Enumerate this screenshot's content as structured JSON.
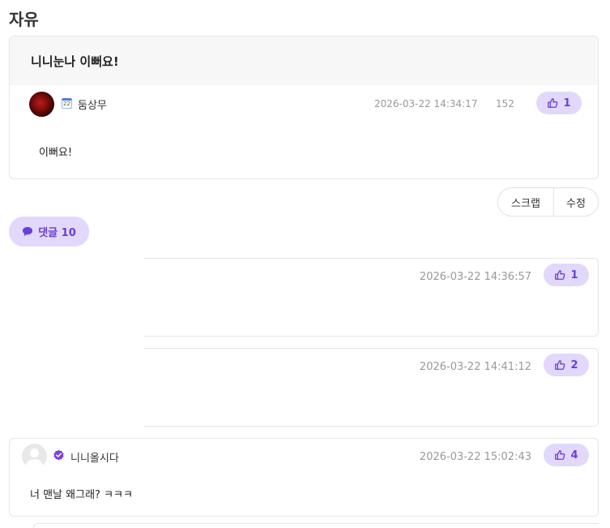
{
  "board": {
    "title": "자유"
  },
  "post": {
    "title": "니니눈나 이뻐요!",
    "author": "둠상무",
    "badge_day": "22",
    "date": "2026-03-22 14:34:17",
    "views": "152",
    "likes": "1",
    "body": "이뻐요!"
  },
  "actions": {
    "scrap_label": "스크랩",
    "edit_label": "수정"
  },
  "comments_toggle": {
    "label": "댓글 10"
  },
  "comments": [
    {
      "date": "2026-03-22 14:36:57",
      "likes": "1"
    },
    {
      "date": "2026-03-22 14:41:12",
      "likes": "2"
    },
    {
      "author": "니니올시다",
      "date": "2026-03-22 15:02:43",
      "likes": "4",
      "text": "너 맨날 왜그래? ㅋㅋㅋ"
    }
  ],
  "colors": {
    "accent": "#6a3fd6",
    "accent_bg": "#e1d8fb",
    "muted": "#999999"
  },
  "icons": {
    "like": "thumbs-up-icon",
    "comment": "speech-bubble-icon",
    "verified": "verified-check-icon"
  }
}
